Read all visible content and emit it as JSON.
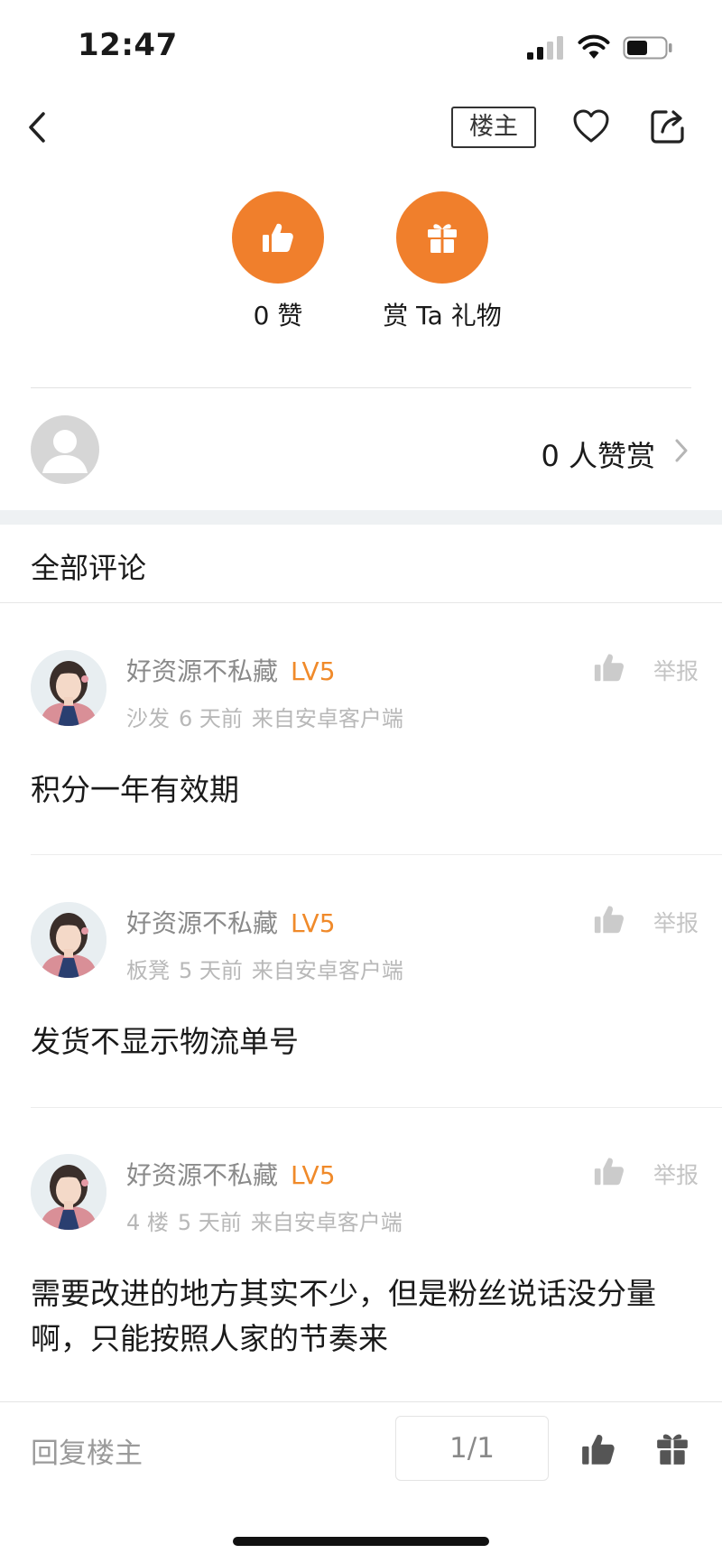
{
  "status_bar": {
    "time": "12:47"
  },
  "nav": {
    "owner_label": "楼主"
  },
  "actions": {
    "like_label": "0 赞",
    "gift_label": "赏 Ta 礼物"
  },
  "appreciators": {
    "count_label": "0 人赞赏"
  },
  "comments_header": "全部评论",
  "comments": [
    {
      "user": "好资源不私藏",
      "level": "LV5",
      "floor": "沙发",
      "time": "6 天前",
      "source": "来自安卓客户端",
      "report": "举报",
      "text": "积分一年有效期"
    },
    {
      "user": "好资源不私藏",
      "level": "LV5",
      "floor": "板凳",
      "time": "5 天前",
      "source": "来自安卓客户端",
      "report": "举报",
      "text": "发货不显示物流单号"
    },
    {
      "user": "好资源不私藏",
      "level": "LV5",
      "floor": "4 楼",
      "time": "5 天前",
      "source": "来自安卓客户端",
      "report": "举报",
      "text": "需要改进的地方其实不少，但是粉丝说话没分量啊，只能按照人家的节奏来"
    }
  ],
  "bottom_bar": {
    "reply_placeholder": "回复楼主",
    "page": "1/1"
  },
  "colors": {
    "accent": "#f07f2c",
    "level": "#f08a2a",
    "section_gap": "#eef1f3"
  }
}
